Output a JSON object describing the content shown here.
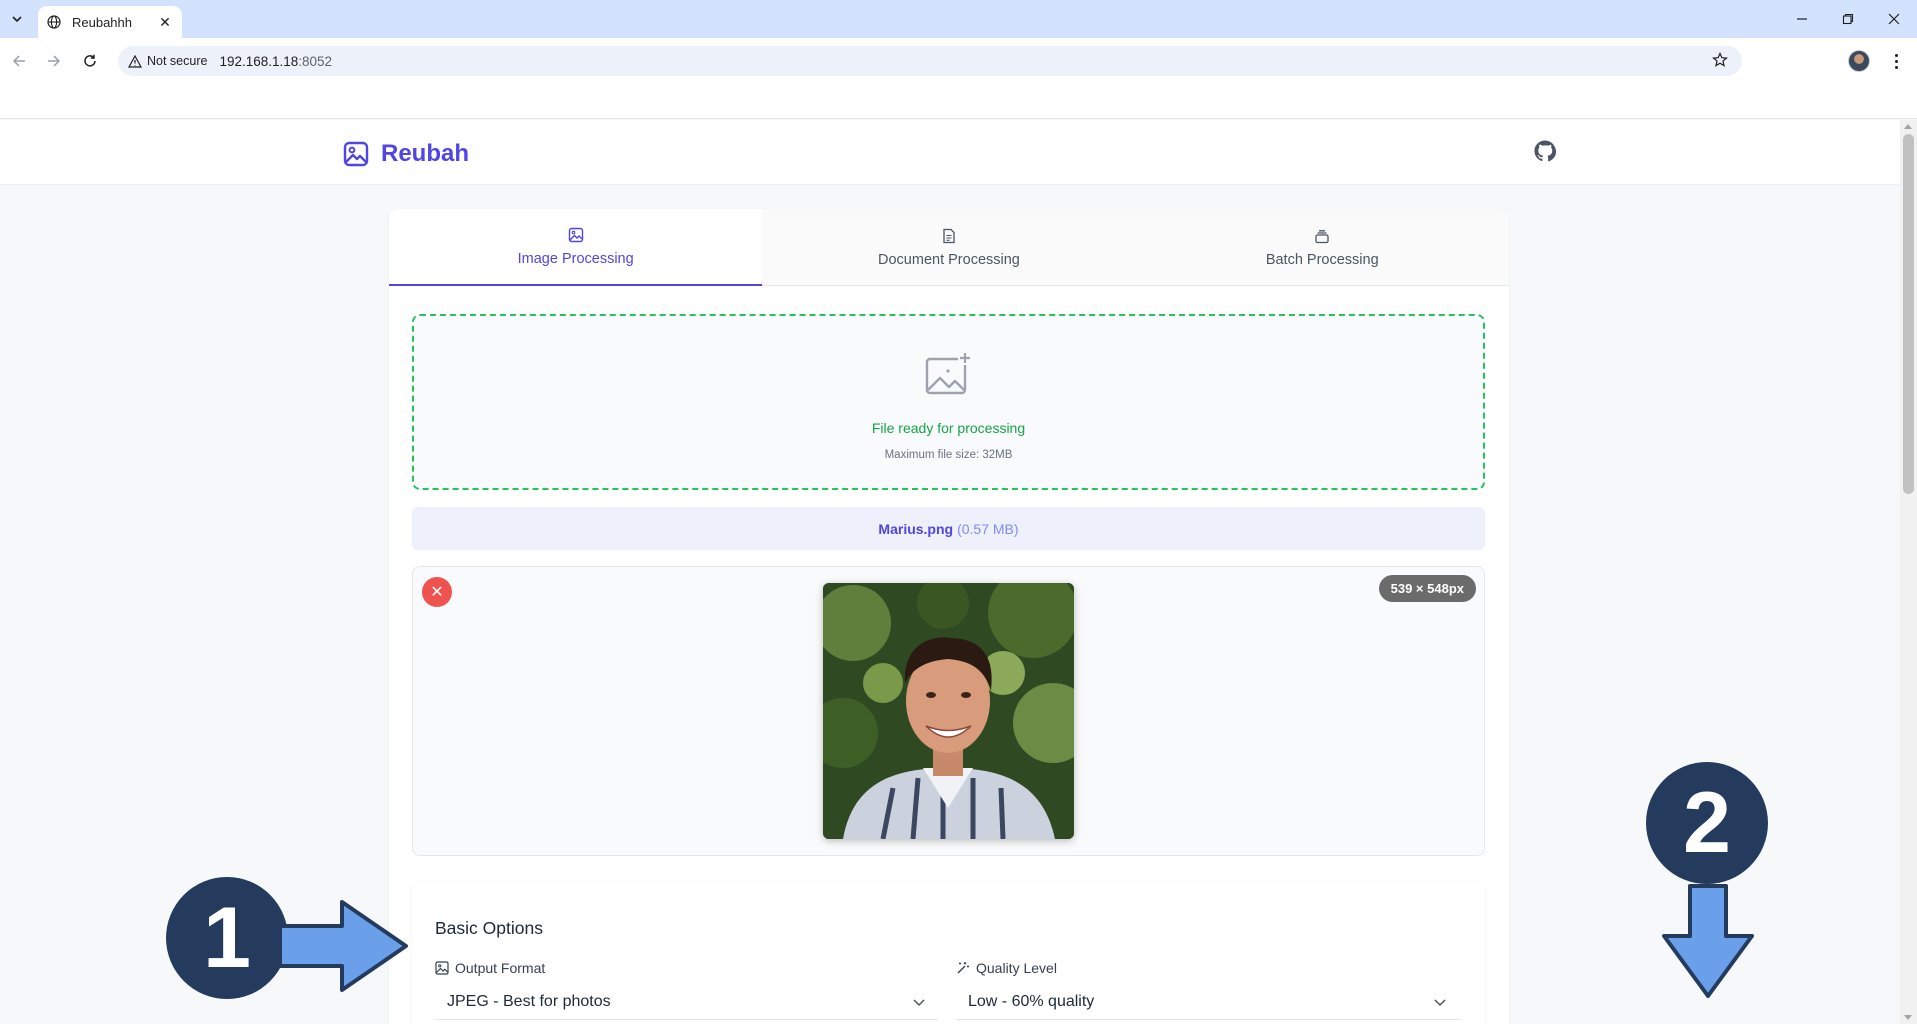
{
  "browser": {
    "tab_title": "Reubahhh",
    "security_label": "Not secure",
    "url_host": "192.168.1.18",
    "url_port": ":8052"
  },
  "app": {
    "brand": "Reubah",
    "tabs": [
      {
        "label": "Image Processing",
        "icon": "image-icon",
        "active": true
      },
      {
        "label": "Document Processing",
        "icon": "document-icon",
        "active": false
      },
      {
        "label": "Batch Processing",
        "icon": "batch-icon",
        "active": false
      }
    ],
    "dropzone": {
      "status": "File ready for processing",
      "limit": "Maximum file size: 32MB"
    },
    "file": {
      "name": "Marius.png",
      "size": "(0.57 MB)"
    },
    "preview": {
      "dimensions": "539 × 548px"
    },
    "options": {
      "title": "Basic Options",
      "output_format_label": "Output Format",
      "output_format_value": "JPEG - Best for photos",
      "quality_label": "Quality Level",
      "quality_value": "Low - 60% quality"
    }
  },
  "overlays": {
    "step1": "1",
    "step2": "2"
  },
  "colors": {
    "accent": "#4f46e5",
    "success": "#16a34a",
    "badge": "#243b5e",
    "arrow": "#6aa0ea"
  }
}
